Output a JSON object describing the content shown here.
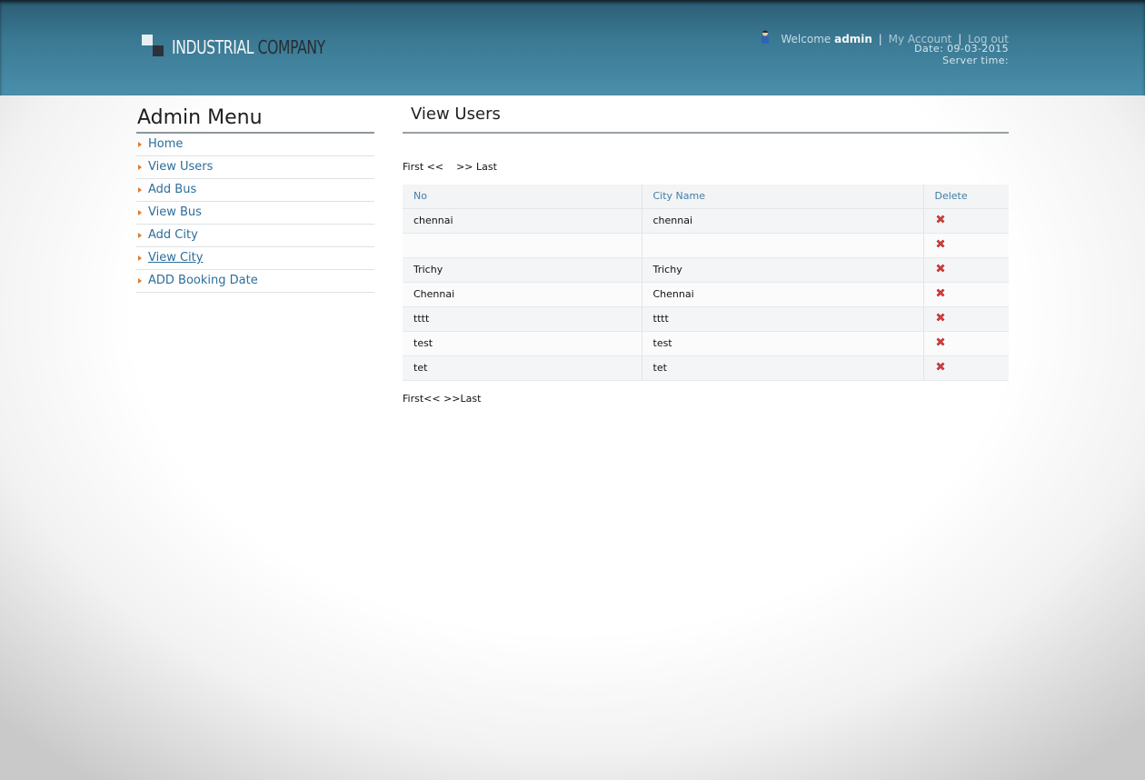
{
  "header": {
    "logo_word1": "INDUSTRIAL",
    "logo_word2": "COMPANY",
    "welcome_text": "Welcome",
    "username": "admin",
    "separator": "|",
    "my_account": "My Account",
    "logout": "Log out",
    "date_text": "Date: 09-03-2015",
    "server_time_text": "Server time:"
  },
  "sidebar": {
    "title": "Admin Menu",
    "items": [
      {
        "label": "Home"
      },
      {
        "label": "View Users"
      },
      {
        "label": "Add Bus"
      },
      {
        "label": "View Bus"
      },
      {
        "label": "Add City"
      },
      {
        "label": "View City"
      },
      {
        "label": "ADD Booking Date"
      }
    ]
  },
  "main": {
    "title": "View Users",
    "pager_top": {
      "first": "First <<",
      "last": ">> Last"
    },
    "table": {
      "headers": [
        "No",
        "City Name",
        "Delete"
      ],
      "rows": [
        [
          "chennai",
          "chennai"
        ],
        [
          "",
          ""
        ],
        [
          "Trichy",
          "Trichy"
        ],
        [
          "Chennai",
          "Chennai"
        ],
        [
          "tttt",
          "tttt"
        ],
        [
          "test",
          "test"
        ],
        [
          "tet",
          "tet"
        ]
      ]
    },
    "pager_bottom": {
      "first": "First<<",
      "last": ">>Last"
    }
  },
  "colors": {
    "header_blue": "#3a7892",
    "link_blue": "#2d6e9a",
    "menu_arrow": "#e07a2a",
    "delete_red": "#d84040"
  }
}
